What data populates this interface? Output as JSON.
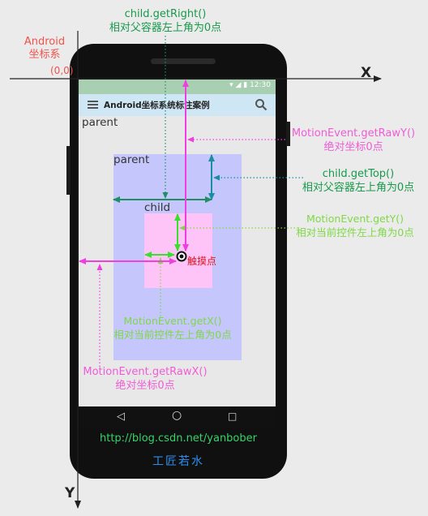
{
  "phone": {
    "status_time": "12:30",
    "status_icons": "▾ ◢ ▮",
    "app_title": "Android坐标系统标注案例",
    "nav_back": "◁",
    "nav_home": "○",
    "nav_recent": "□"
  },
  "origin": {
    "title_line1": "Android",
    "title_line2": "坐标系",
    "coords": "(0,0)"
  },
  "axes": {
    "x_label": "X",
    "y_label": "Y"
  },
  "views": {
    "outer_parent": "parent",
    "inner_parent": "parent",
    "child": "child",
    "touch_point": "触摸点"
  },
  "annotations": {
    "get_right": {
      "method": "child.getRight()",
      "desc": "相对父容器左上角为0点"
    },
    "raw_y": {
      "method": "MotionEvent.getRawY()",
      "desc": "绝对坐标0点"
    },
    "get_top": {
      "method": "child.getTop()",
      "desc": "相对父容器左上角为0点"
    },
    "get_y": {
      "method": "MotionEvent.getY()",
      "desc": "相对当前控件左上角为0点"
    },
    "get_x": {
      "method": "MotionEvent.getX()",
      "desc": "相对当前控件左上角为0点"
    },
    "raw_x": {
      "method": "MotionEvent.getRawX()",
      "desc": "绝对坐标0点"
    }
  },
  "footer": {
    "url": "http://blog.csdn.net/yanbober",
    "brand": "工匠若水"
  },
  "colors": {
    "get_right_top": "#169a4a",
    "get_x_y": "#7fd845",
    "raw_x_y": "#ef5cd6",
    "origin": "#f1524c",
    "parent_view": "#c5c6fb",
    "child_view": "#ffc4f7",
    "touch_label": "#e0141e",
    "footer_url": "#36d46a",
    "footer_brand": "#2e8ef0"
  }
}
